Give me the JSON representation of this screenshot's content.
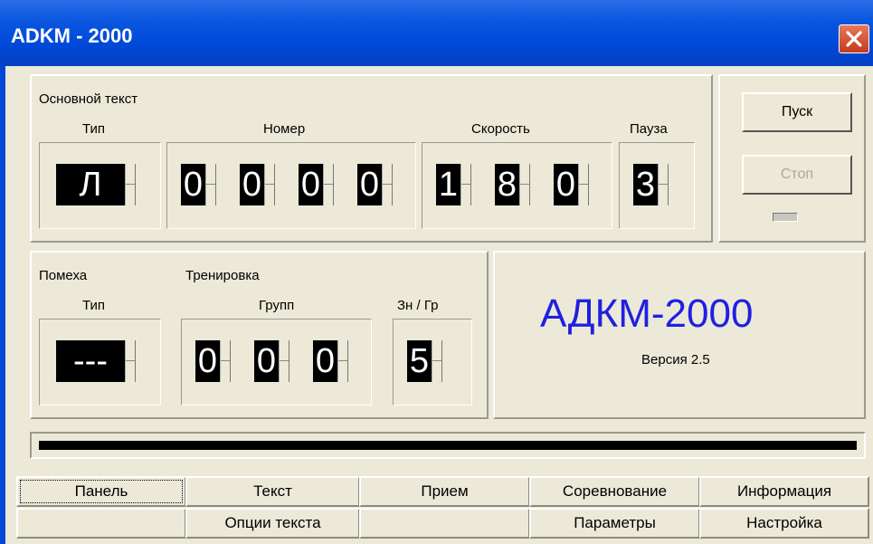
{
  "window": {
    "title": "ADKM - 2000"
  },
  "main_text": {
    "heading": "Основной текст",
    "type_label": "Тип",
    "type_value": "Л",
    "number_label": "Номер",
    "number_digits": [
      "0",
      "0",
      "0",
      "0"
    ],
    "speed_label": "Скорость",
    "speed_digits": [
      "1",
      "8",
      "0"
    ],
    "pause_label": "Пауза",
    "pause_digits": [
      "3"
    ]
  },
  "controls": {
    "start_label": "Пуск",
    "stop_label": "Стоп"
  },
  "interference": {
    "heading": "Помеха",
    "type_label": "Тип",
    "type_value": "---"
  },
  "training": {
    "heading": "Тренировка",
    "groups_label": "Групп",
    "groups_digits": [
      "0",
      "0",
      "0"
    ],
    "signs_label": "Зн / Гр",
    "signs_digits": [
      "5"
    ]
  },
  "about": {
    "product": "АДКМ-2000",
    "version": "Версия 2.5"
  },
  "progress": {
    "fraction": 1.0
  },
  "tabs_row1": [
    "Панель",
    "Текст",
    "Прием",
    "Соревнование",
    "Информация"
  ],
  "tabs_row2": [
    "",
    "Опции текста",
    "",
    "Параметры",
    "Настройка"
  ],
  "colors": {
    "titlebar": "#0048d8",
    "logo": "#2020e0",
    "digit_bg": "#000000",
    "digit_fg": "#ffffff"
  }
}
